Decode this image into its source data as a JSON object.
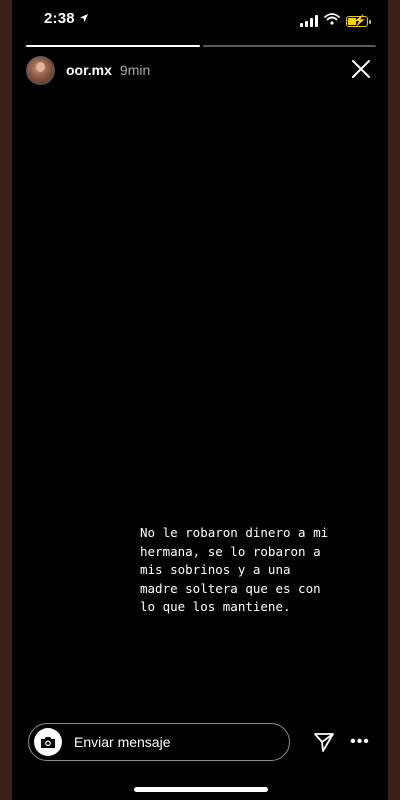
{
  "status_bar": {
    "time": "2:38",
    "location_icon": "location-arrow-icon",
    "signal_icon": "cellular-signal-icon",
    "wifi_icon": "wifi-icon",
    "battery_icon": "battery-charging-icon",
    "battery_color": "#f5d20a"
  },
  "story": {
    "progress_segments": [
      1.0,
      0.0
    ],
    "username": "oor.mx",
    "time_ago": "9min",
    "close_icon": "close-icon",
    "caption": "No le robaron dinero a mi\nhermana, se lo robaron a\nmis sobrinos y a una\nmadre soltera que es con\nlo que los mantiene."
  },
  "reply_bar": {
    "camera_icon": "camera-icon",
    "placeholder": "Enviar mensaje",
    "send_icon": "send-icon",
    "more_icon": "more-options-icon",
    "more_glyph": "•••"
  },
  "colors": {
    "frame": "#3b1f1a",
    "background": "#000000",
    "text": "#ffffff"
  }
}
